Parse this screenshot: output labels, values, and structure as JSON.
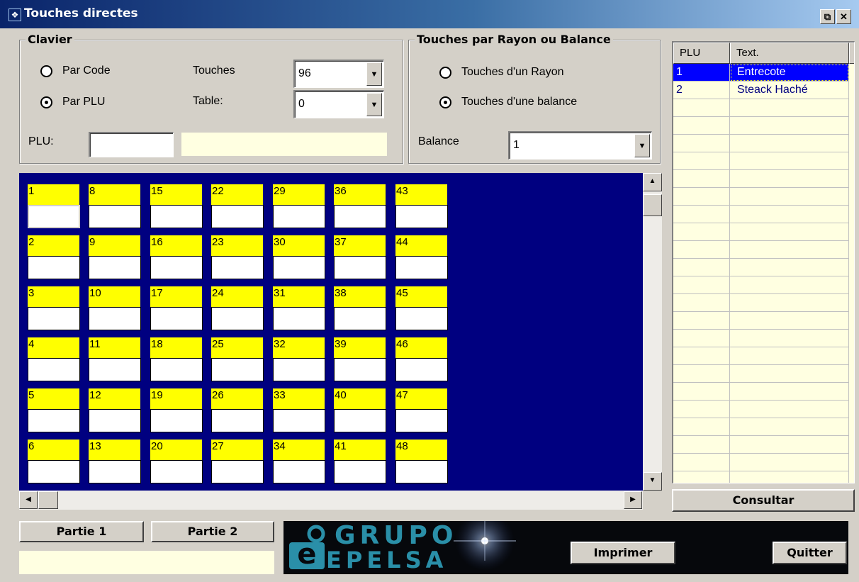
{
  "window": {
    "title": "Touches directes",
    "restore_btn": "⧉",
    "close_btn": "✕"
  },
  "clavier": {
    "legend": "Clavier",
    "radio_code": "Par Code",
    "radio_plu": "Par PLU",
    "touches_label": "Touches",
    "touches_value": "96",
    "table_label": "Table:",
    "table_value": "0",
    "plu_label": "PLU:",
    "plu_value": "",
    "plu_desc": "",
    "selected": "plu"
  },
  "rayon": {
    "legend": "Touches par Rayon ou Balance",
    "radio_rayon": "Touches d'un Rayon",
    "radio_balance": "Touches d'une balance",
    "balance_label": "Balance",
    "balance_value": "1",
    "selected": "balance"
  },
  "keys": {
    "columns": [
      [
        "1",
        "2",
        "3",
        "4",
        "5",
        "6"
      ],
      [
        "8",
        "9",
        "10",
        "11",
        "12",
        "13"
      ],
      [
        "15",
        "16",
        "17",
        "18",
        "19",
        "20"
      ],
      [
        "22",
        "23",
        "24",
        "25",
        "26",
        "27"
      ],
      [
        "29",
        "30",
        "31",
        "32",
        "33",
        "34"
      ],
      [
        "36",
        "37",
        "38",
        "39",
        "40",
        "41"
      ],
      [
        "43",
        "44",
        "45",
        "46",
        "47",
        "48"
      ]
    ]
  },
  "plu_list": {
    "headers": [
      "PLU",
      "Text."
    ],
    "rows": [
      {
        "plu": "1",
        "text": "Entrecote",
        "selected": true
      },
      {
        "plu": "2",
        "text": "Steack Haché",
        "selected": false
      }
    ]
  },
  "buttons": {
    "consultar": "Consultar",
    "partie1": "Partie 1",
    "partie2": "Partie 2",
    "imprimer": "Imprimer",
    "quitter": "Quitter"
  },
  "status_text": "",
  "logo": {
    "line1": "GRUPO",
    "line2": "EPELSA",
    "mark": "e"
  }
}
